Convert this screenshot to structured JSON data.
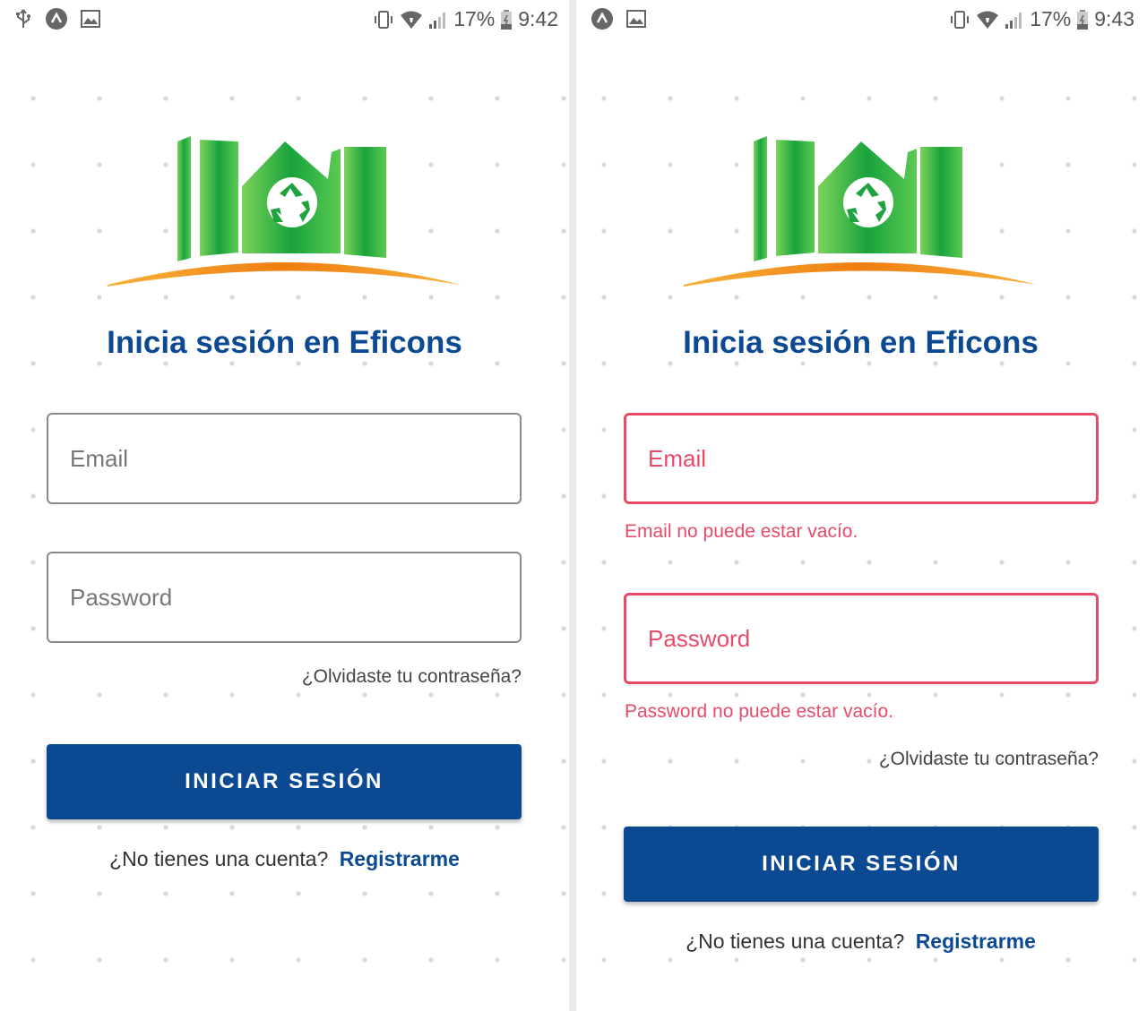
{
  "status_bars": [
    {
      "battery": "17%",
      "time": "9:42"
    },
    {
      "battery": "17%",
      "time": "9:43"
    }
  ],
  "icons": {
    "usb": "usb-icon",
    "app": "app-icon",
    "gallery": "image-icon",
    "vibrate": "vibrate-icon",
    "wifi": "wifi-icon",
    "signal": "signal-icon",
    "battery": "battery-icon",
    "logo": "eficons-logo"
  },
  "colors": {
    "primary": "#0b4a93",
    "error": "#e84a6a",
    "logo_green": "#2db34a",
    "logo_orange": "#f39214"
  },
  "screens": [
    {
      "title": "Inicia sesión en Eficons",
      "email_placeholder": "Email",
      "password_placeholder": "Password",
      "forgot": "¿Olvidaste tu contraseña?",
      "login_button": "INICIAR SESIÓN",
      "no_account": "¿No tienes una cuenta?",
      "register_link": "Registrarme"
    },
    {
      "title": "Inicia sesión en Eficons",
      "email_placeholder": "Email",
      "email_error": "Email no puede estar vacío.",
      "password_placeholder": "Password",
      "password_error": "Password no puede estar vacío.",
      "forgot": "¿Olvidaste tu contraseña?",
      "login_button": "INICIAR SESIÓN",
      "no_account": "¿No tienes una cuenta?",
      "register_link": "Registrarme"
    }
  ]
}
